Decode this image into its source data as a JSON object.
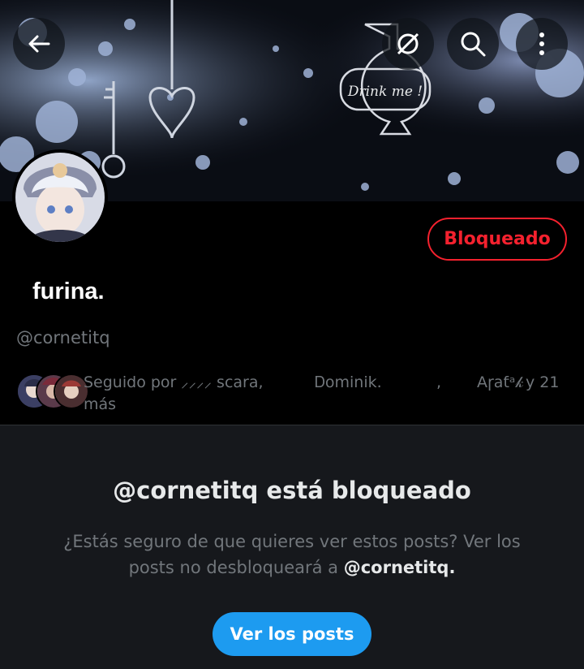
{
  "banner": {
    "bottle_label": "Drink me !"
  },
  "header": {
    "back_icon": "arrow-left-icon",
    "grok_icon": "grok-icon",
    "search_icon": "search-icon",
    "more_icon": "more-vertical-icon"
  },
  "profile": {
    "display_name": "furina.",
    "handle": "@cornetitq",
    "blocked_label": "Bloqueado"
  },
  "followed_by": {
    "prefix": "Seguido por",
    "names_line": "⸝⸝⸝⸝ scara,",
    "name2": "Ꭰominik.",
    "sep": ",",
    "name3": "Aɼaƭᵃ𝓀",
    "more_count": "y 21",
    "more_word": "más"
  },
  "blocked_notice": {
    "title": "@cornetitq está bloqueado",
    "desc_part1": "¿Estás seguro de que quieres ver estos posts? Ver los posts no desbloqueará a ",
    "desc_handle": "@cornetitq.",
    "button": "Ver los posts"
  },
  "colors": {
    "accent": "#1d9bf0",
    "blocked": "#f4212e",
    "muted": "#71767b",
    "panel": "#16181c"
  }
}
